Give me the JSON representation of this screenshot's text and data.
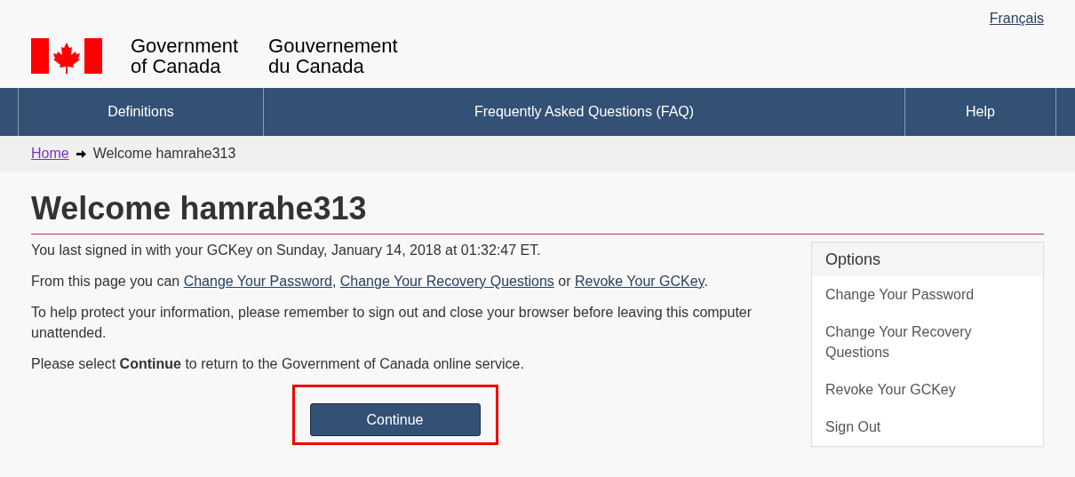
{
  "language_link": "Français",
  "signature": {
    "english": [
      "Government",
      "of Canada"
    ],
    "french": [
      "Gouvernement",
      "du Canada"
    ]
  },
  "nav": [
    {
      "label": "Definitions"
    },
    {
      "label": "Frequently Asked Questions (FAQ)"
    },
    {
      "label": "Help"
    }
  ],
  "breadcrumb": {
    "home": "Home",
    "current": "Welcome hamrahe313"
  },
  "heading": "Welcome hamrahe313",
  "paragraphs": [
    [
      {
        "kind": "text",
        "text": "You last signed in with your GCKey on Sunday, January 14, 2018 at 01:32:47 ET."
      }
    ],
    [
      {
        "kind": "text",
        "text": "From this page you can "
      },
      {
        "kind": "link",
        "text": "Change Your Password"
      },
      {
        "kind": "text",
        "text": ", "
      },
      {
        "kind": "link",
        "text": "Change Your Recovery Questions"
      },
      {
        "kind": "text",
        "text": " or "
      },
      {
        "kind": "link",
        "text": "Revoke Your GCKey"
      },
      {
        "kind": "text",
        "text": "."
      }
    ],
    [
      {
        "kind": "text",
        "text": "To help protect your information, please remember to sign out and close your browser before leaving this computer unattended."
      }
    ],
    [
      {
        "kind": "text",
        "text": "Please select **Continue** to return to the Government of Canada online service."
      }
    ]
  ],
  "continue_button": {
    "label": "Continue",
    "highlighted": true
  },
  "options": {
    "title": "Options",
    "items": [
      "Change Your Password",
      "Change Your Recovery Questions",
      "Revoke Your GCKey",
      "Sign Out"
    ]
  }
}
